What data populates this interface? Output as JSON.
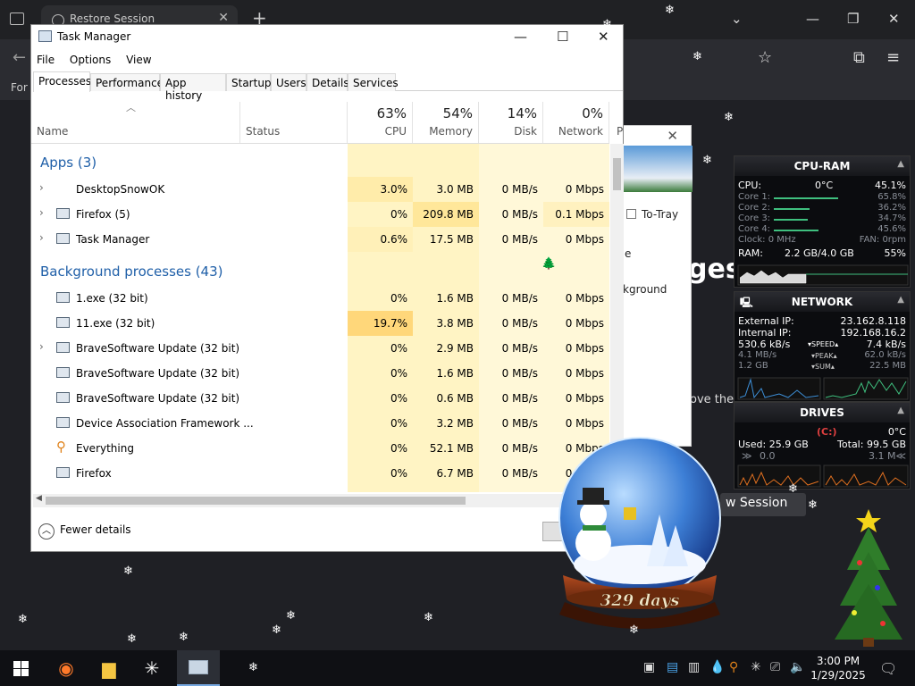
{
  "browser": {
    "tab_title": "Restore Session",
    "for_text": "For",
    "ges_text": "ges",
    "ove_text": "ove the",
    "view_session": "w Session"
  },
  "dialog2": {
    "to_tray": "To-Tray",
    "e_text": "e",
    "bg_text": "kground"
  },
  "taskmgr": {
    "title": "Task Manager",
    "menu": [
      "File",
      "Options",
      "View"
    ],
    "tabs": [
      "Processes",
      "Performance",
      "App history",
      "Startup",
      "Users",
      "Details",
      "Services"
    ],
    "headers": {
      "name": "Name",
      "status": "Status",
      "cpu_pct": "63%",
      "cpu": "CPU",
      "mem_pct": "54%",
      "mem": "Memory",
      "disk_pct": "14%",
      "disk": "Disk",
      "net_pct": "0%",
      "net": "Network",
      "p": "P"
    },
    "apps_group": "Apps (3)",
    "bg_group": "Background processes (43)",
    "apps": [
      {
        "name": "DesktopSnowOK",
        "cpu": "3.0%",
        "mem": "3.0 MB",
        "disk": "0 MB/s",
        "net": "0 Mbps"
      },
      {
        "name": "Firefox (5)",
        "cpu": "0%",
        "mem": "209.8 MB",
        "disk": "0 MB/s",
        "net": "0.1 Mbps"
      },
      {
        "name": "Task Manager",
        "cpu": "0.6%",
        "mem": "17.5 MB",
        "disk": "0 MB/s",
        "net": "0 Mbps"
      }
    ],
    "bg": [
      {
        "name": "1.exe (32 bit)",
        "cpu": "0%",
        "mem": "1.6 MB",
        "disk": "0 MB/s",
        "net": "0 Mbps"
      },
      {
        "name": "11.exe (32 bit)",
        "cpu": "19.7%",
        "mem": "3.8 MB",
        "disk": "0 MB/s",
        "net": "0 Mbps"
      },
      {
        "name": "BraveSoftware Update (32 bit)",
        "cpu": "0%",
        "mem": "2.9 MB",
        "disk": "0 MB/s",
        "net": "0 Mbps"
      },
      {
        "name": "BraveSoftware Update (32 bit)",
        "cpu": "0%",
        "mem": "1.6 MB",
        "disk": "0 MB/s",
        "net": "0 Mbps"
      },
      {
        "name": "BraveSoftware Update (32 bit)",
        "cpu": "0%",
        "mem": "0.6 MB",
        "disk": "0 MB/s",
        "net": "0 Mbps"
      },
      {
        "name": "Device Association Framework ...",
        "cpu": "0%",
        "mem": "3.2 MB",
        "disk": "0 MB/s",
        "net": "0 Mbps"
      },
      {
        "name": "Everything",
        "cpu": "0%",
        "mem": "52.1 MB",
        "disk": "0 MB/s",
        "net": "0 Mbps"
      },
      {
        "name": "Firefox",
        "cpu": "0%",
        "mem": "6.7 MB",
        "disk": "0 MB/s",
        "net": "0 Mbps"
      }
    ],
    "fewer_details": "Fewer details"
  },
  "cpu_ram": {
    "title": "CPU-RAM",
    "cpu_label": "CPU:",
    "cpu_temp": "0°C",
    "cpu_val": "45.1%",
    "cores": [
      {
        "label": "Core 1:",
        "val": "65.8%",
        "level": 0.658
      },
      {
        "label": "Core 2:",
        "val": "36.2%",
        "level": 0.362
      },
      {
        "label": "Core 3:",
        "val": "34.7%",
        "level": 0.347
      },
      {
        "label": "Core 4:",
        "val": "45.6%",
        "level": 0.456
      }
    ],
    "clock": "Clock: 0 MHz",
    "fan": "FAN: 0rpm",
    "ram_label": "RAM:",
    "ram_val": "2.2 GB/4.0 GB",
    "ram_pct": "55%"
  },
  "network": {
    "title": "NETWORK",
    "ext_label": "External IP:",
    "ext_ip": "23.162.8.118",
    "int_label": "Internal IP:",
    "int_ip": "192.168.16.2",
    "speed_l": "530.6 kB/s",
    "speed": "SPEED",
    "speed_r": "7.4 kB/s",
    "peak_l": "4.1 MB/s",
    "peak": "PEAK",
    "peak_r": "62.0 kB/s",
    "sum_l": "1.2 GB",
    "sum": "SUM",
    "sum_r": "22.5 MB"
  },
  "drives": {
    "title": "DRIVES",
    "drive": "(C:)",
    "temp": "0°C",
    "used": "Used: 25.9 GB",
    "total": "Total: 99.5 GB",
    "read": "0.0",
    "write": "3.1 M"
  },
  "globe": {
    "days": "329 days"
  },
  "taskbar": {
    "time": "3:00 PM",
    "date": "1/29/2025"
  }
}
